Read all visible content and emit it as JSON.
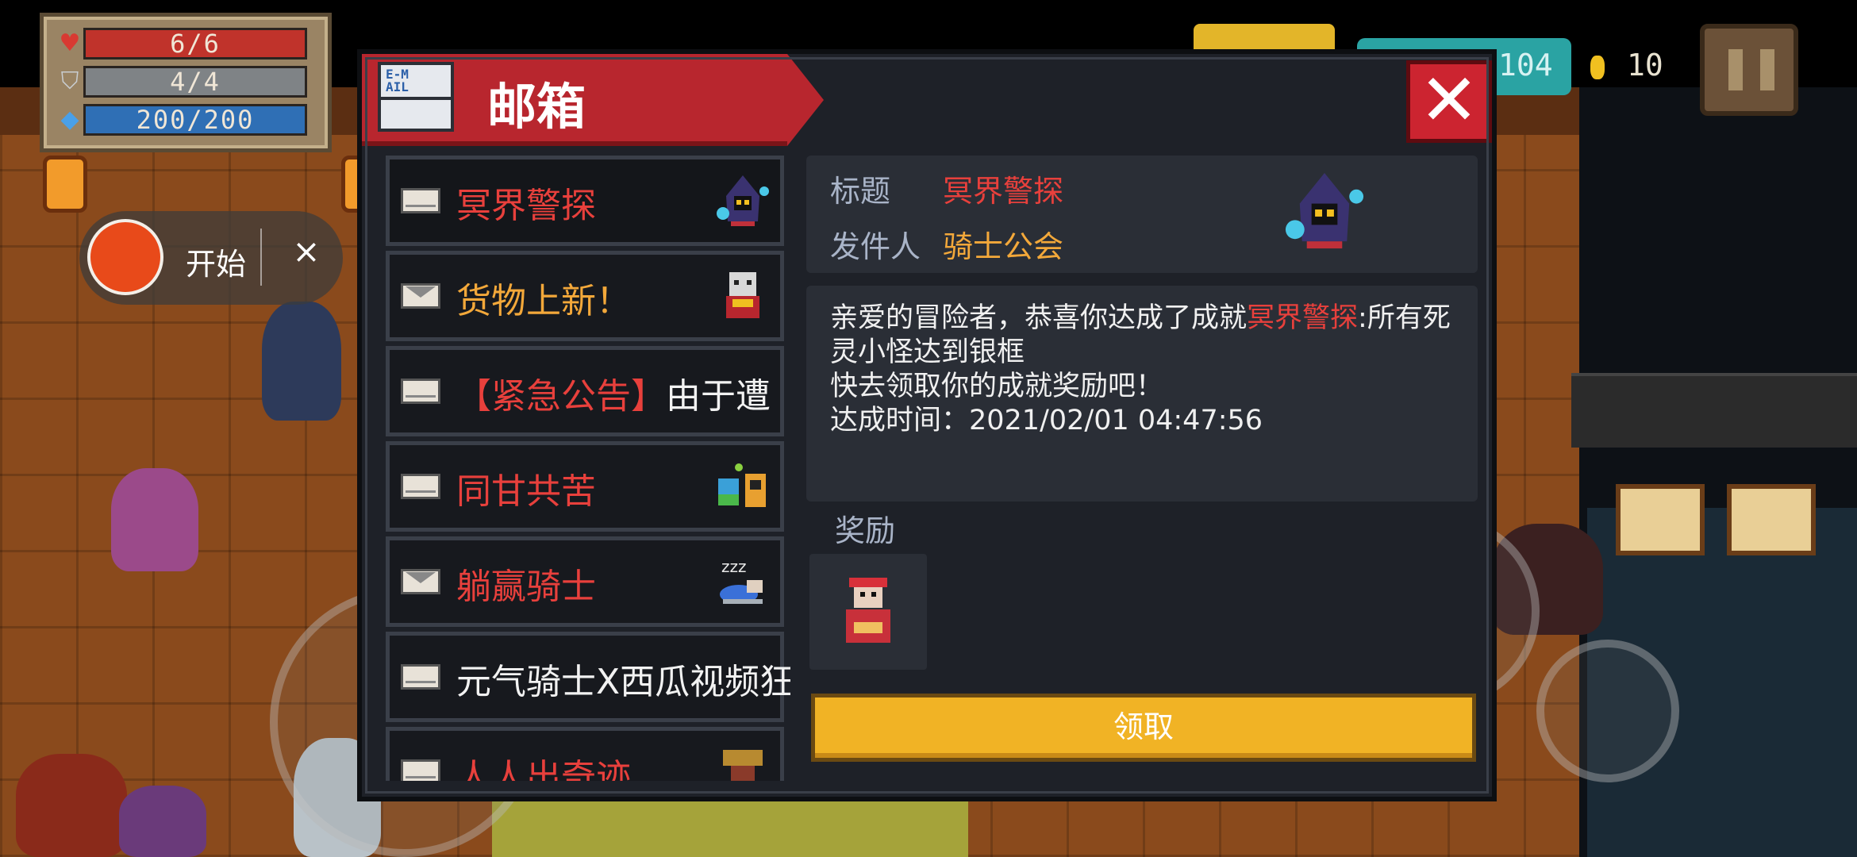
{
  "hud": {
    "hp": "6/6",
    "armor": "4/4",
    "energy": "200/200"
  },
  "recorder": {
    "start_label": "开始",
    "close_label": "×"
  },
  "currency": {
    "gems": "104",
    "coins": "10"
  },
  "mailbox": {
    "title": "邮箱",
    "mail_icon_text": "E-M\nAIL",
    "close_label": "✕",
    "items": [
      {
        "name": "冥界警探",
        "color": "#e8403c",
        "opened": true
      },
      {
        "name": "货物上新！",
        "color": "#f3a83a",
        "opened": false
      },
      {
        "name_prefix": "【紧急公告】",
        "name_suffix": "由于遭",
        "color": "#e8403c",
        "opened": true
      },
      {
        "name": "同甘共苦",
        "color": "#e8403c",
        "opened": true
      },
      {
        "name": "躺赢骑士",
        "color": "#e8403c",
        "opened": false
      },
      {
        "name": "元气骑士X西瓜视频狂",
        "color": "#f2f2f2",
        "opened": true
      },
      {
        "name": "人人出奇迹",
        "color": "#e8403c",
        "opened": true
      }
    ],
    "detail": {
      "subject_label": "标题",
      "subject": "冥界警探",
      "sender_label": "发件人",
      "sender": "骑士公会",
      "body_pre": "亲爱的冒险者，恭喜你达成了成就",
      "body_highlight": "冥界警探",
      "body_post": ":所有死灵小怪达到银框",
      "body_line2": "快去领取你的成就奖励吧！",
      "body_line3": "达成时间：2021/02/01 04:47:56",
      "reward_label": "奖励",
      "claim_label": "领取"
    }
  }
}
